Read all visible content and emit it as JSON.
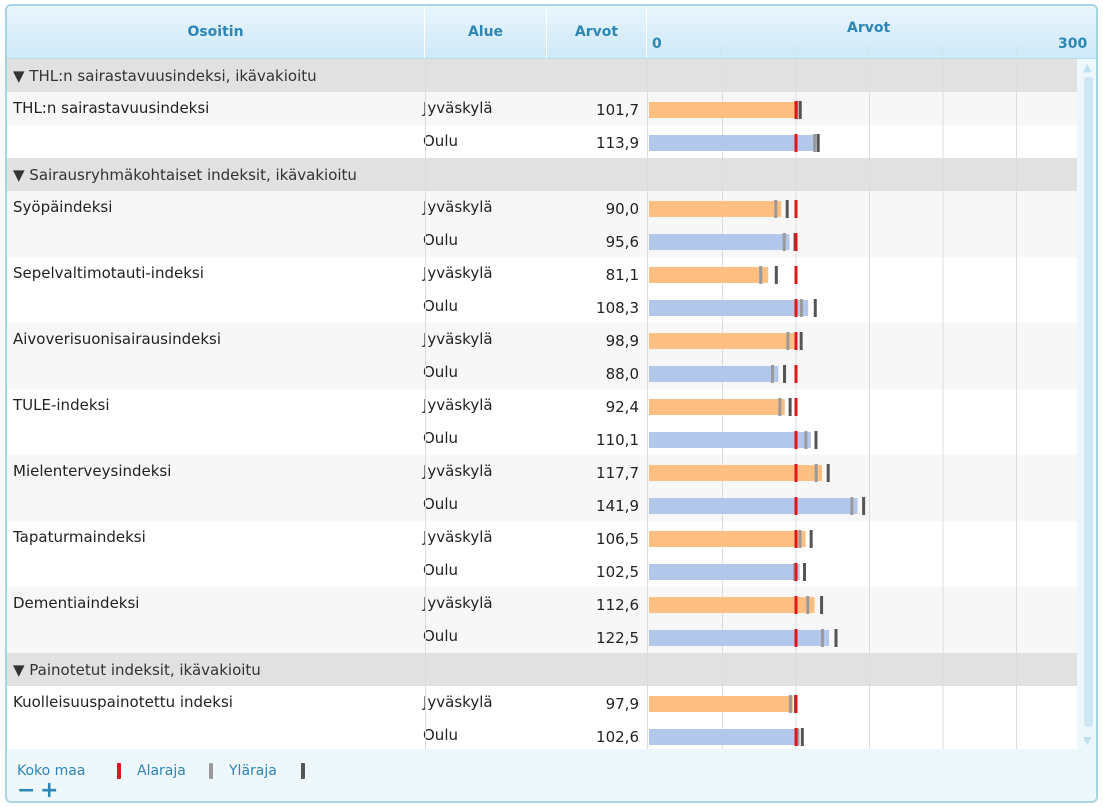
{
  "header": {
    "col_indicator": "Osoitin",
    "col_area": "Alue",
    "col_value": "Arvot",
    "col_chart": "Arvot",
    "axis_min_label": "0",
    "axis_max_label": "300"
  },
  "colors": {
    "jyvaskyla_bar": "#ffbf80",
    "oulu_bar": "#b3c7ea",
    "whole_country": "#e0161b",
    "lower_limit": "#9a9a9a",
    "upper_limit": "#555555",
    "header_text": "#2d86b5"
  },
  "legend": {
    "whole_country": "Koko maa",
    "lower_limit": "Alaraja",
    "upper_limit": "Yläraja"
  },
  "zoom": {
    "minus": "−",
    "plus": "+"
  },
  "icons": {
    "collapse": "triangle-down-icon"
  },
  "groups": [
    {
      "label": "▼ THL:n sairastavuusindeksi, ikävakioitu"
    },
    {
      "label": "▼ Sairausryhmäkohtaiset indeksit, ikävakioitu"
    },
    {
      "label": "▼ Painotetut indeksit, ikävakioitu"
    }
  ],
  "rows": [
    {
      "indicator": "THL:n sairastavuusindeksi",
      "area": "Jyväskylä",
      "value_text": "101,7"
    },
    {
      "indicator": "",
      "area": "Oulu",
      "value_text": "113,9"
    },
    {
      "indicator": "Syöpäindeksi",
      "area": "Jyväskylä",
      "value_text": "90,0"
    },
    {
      "indicator": "",
      "area": "Oulu",
      "value_text": "95,6"
    },
    {
      "indicator": "Sepelvaltimotauti-indeksi",
      "area": "Jyväskylä",
      "value_text": "81,1"
    },
    {
      "indicator": "",
      "area": "Oulu",
      "value_text": "108,3"
    },
    {
      "indicator": "Aivoverisuonisairausindeksi",
      "area": "Jyväskylä",
      "value_text": "98,9"
    },
    {
      "indicator": "",
      "area": "Oulu",
      "value_text": "88,0"
    },
    {
      "indicator": "TULE-indeksi",
      "area": "Jyväskylä",
      "value_text": "92,4"
    },
    {
      "indicator": "",
      "area": "Oulu",
      "value_text": "110,1"
    },
    {
      "indicator": "Mielenterveysindeksi",
      "area": "Jyväskylä",
      "value_text": "117,7"
    },
    {
      "indicator": "",
      "area": "Oulu",
      "value_text": "141,9"
    },
    {
      "indicator": "Tapaturmaindeksi",
      "area": "Jyväskylä",
      "value_text": "106,5"
    },
    {
      "indicator": "",
      "area": "Oulu",
      "value_text": "102,5"
    },
    {
      "indicator": "Dementiaindeksi",
      "area": "Jyväskylä",
      "value_text": "112,6"
    },
    {
      "indicator": "",
      "area": "Oulu",
      "value_text": "122,5"
    },
    {
      "indicator": "Kuolleisuuspainotettu indeksi",
      "area": "Jyväskylä",
      "value_text": "97,9"
    },
    {
      "indicator": "",
      "area": "Oulu",
      "value_text": "102,6"
    }
  ],
  "chart_data": {
    "type": "bar",
    "orientation": "horizontal",
    "xlim": [
      0,
      300
    ],
    "reference_value": 100,
    "reference_label": "Koko maa",
    "grid": true,
    "series": [
      {
        "name": "Jyväskylä",
        "values": [
          101.7,
          90.0,
          81.1,
          98.9,
          92.4,
          117.7,
          106.5,
          112.6,
          97.9
        ]
      },
      {
        "name": "Oulu",
        "values": [
          113.9,
          95.6,
          108.3,
          88.0,
          110.1,
          141.9,
          102.5,
          122.5,
          102.6
        ]
      }
    ],
    "rows": [
      {
        "indicator": "THL:n sairastavuusindeksi",
        "area": "Jyväskylä",
        "value": 101.7,
        "lower": 100.5,
        "upper": 102.9
      },
      {
        "indicator": "THL:n sairastavuusindeksi",
        "area": "Oulu",
        "value": 113.9,
        "lower": 112.7,
        "upper": 115.1
      },
      {
        "indicator": "Syöpäindeksi",
        "area": "Jyväskylä",
        "value": 90.0,
        "lower": 86.2,
        "upper": 94.0
      },
      {
        "indicator": "Syöpäindeksi",
        "area": "Oulu",
        "value": 95.6,
        "lower": 92.0,
        "upper": 99.4
      },
      {
        "indicator": "Sepelvaltimotauti-indeksi",
        "area": "Jyväskylä",
        "value": 81.1,
        "lower": 76.0,
        "upper": 86.6
      },
      {
        "indicator": "Sepelvaltimotauti-indeksi",
        "area": "Oulu",
        "value": 108.3,
        "lower": 103.7,
        "upper": 113.1
      },
      {
        "indicator": "Aivoverisuonisairausindeksi",
        "area": "Jyväskylä",
        "value": 98.9,
        "lower": 94.5,
        "upper": 103.5
      },
      {
        "indicator": "Aivoverisuonisairausindeksi",
        "area": "Oulu",
        "value": 88.0,
        "lower": 84.0,
        "upper": 92.2
      },
      {
        "indicator": "TULE-indeksi",
        "area": "Jyväskylä",
        "value": 92.4,
        "lower": 89.0,
        "upper": 96.0
      },
      {
        "indicator": "TULE-indeksi",
        "area": "Oulu",
        "value": 110.1,
        "lower": 106.7,
        "upper": 113.6
      },
      {
        "indicator": "Mielenterveysindeksi",
        "area": "Jyväskylä",
        "value": 117.7,
        "lower": 113.7,
        "upper": 121.9
      },
      {
        "indicator": "Mielenterveysindeksi",
        "area": "Oulu",
        "value": 141.9,
        "lower": 138.0,
        "upper": 146.0
      },
      {
        "indicator": "Tapaturmaindeksi",
        "area": "Jyväskylä",
        "value": 106.5,
        "lower": 102.7,
        "upper": 110.3
      },
      {
        "indicator": "Tapaturmaindeksi",
        "area": "Oulu",
        "value": 102.5,
        "lower": 99.2,
        "upper": 105.8
      },
      {
        "indicator": "Dementiaindeksi",
        "area": "Jyväskylä",
        "value": 112.6,
        "lower": 108.0,
        "upper": 117.4
      },
      {
        "indicator": "Dementiaindeksi",
        "area": "Oulu",
        "value": 122.5,
        "lower": 118.0,
        "upper": 127.2
      },
      {
        "indicator": "Kuolleisuuspainotettu indeksi",
        "area": "Jyväskylä",
        "value": 97.9,
        "lower": 96.2,
        "upper": 99.7
      },
      {
        "indicator": "Kuolleisuuspainotettu indeksi",
        "area": "Oulu",
        "value": 102.6,
        "lower": 100.9,
        "upper": 104.3
      }
    ]
  }
}
